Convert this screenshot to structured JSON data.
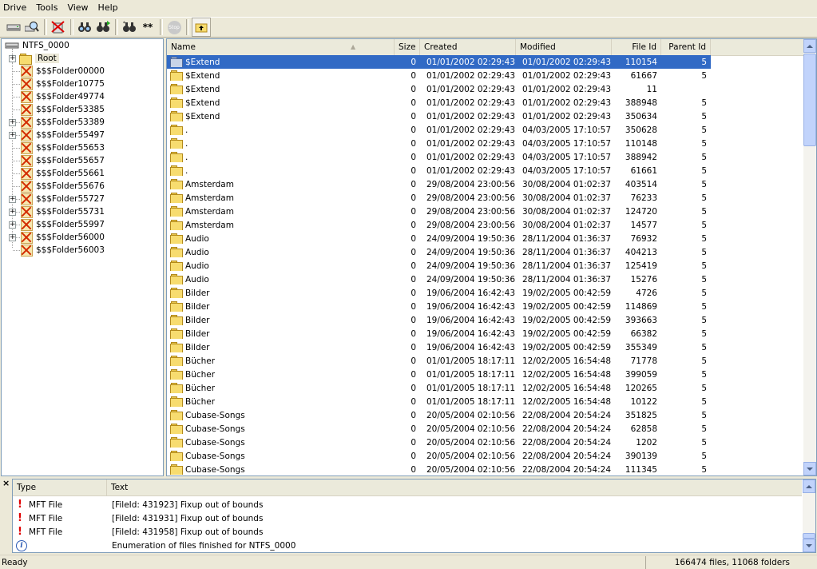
{
  "menu": [
    "Drive",
    "Tools",
    "View",
    "Help"
  ],
  "toolbar": {
    "buttons": [
      "drive-icon",
      "scan-drive-icon",
      "delete-icon",
      "find-icon",
      "find-next-icon",
      "filter-icon",
      "wildcard-icon",
      "stop-icon",
      "up-folder-icon"
    ],
    "stop_label": "Stop",
    "wildcard_label": "**"
  },
  "tree": {
    "drive": "NTFS_0000",
    "root": "Root",
    "folders": [
      {
        "label": "$$$Folder00000",
        "expandable": false
      },
      {
        "label": "$$$Folder10775",
        "expandable": false
      },
      {
        "label": "$$$Folder49774",
        "expandable": false
      },
      {
        "label": "$$$Folder53385",
        "expandable": false
      },
      {
        "label": "$$$Folder53389",
        "expandable": true
      },
      {
        "label": "$$$Folder55497",
        "expandable": true
      },
      {
        "label": "$$$Folder55653",
        "expandable": false
      },
      {
        "label": "$$$Folder55657",
        "expandable": false
      },
      {
        "label": "$$$Folder55661",
        "expandable": false
      },
      {
        "label": "$$$Folder55676",
        "expandable": false
      },
      {
        "label": "$$$Folder55727",
        "expandable": true
      },
      {
        "label": "$$$Folder55731",
        "expandable": true
      },
      {
        "label": "$$$Folder55997",
        "expandable": true
      },
      {
        "label": "$$$Folder56000",
        "expandable": true
      },
      {
        "label": "$$$Folder56003",
        "expandable": false
      }
    ]
  },
  "list": {
    "columns": {
      "name": "Name",
      "size": "Size",
      "created": "Created",
      "modified": "Modified",
      "file_id": "File Id",
      "parent_id": "Parent Id"
    },
    "rows": [
      {
        "name": "$Extend",
        "size": "0",
        "created": "01/01/2002 02:29:43",
        "modified": "01/01/2002 02:29:43",
        "file_id": "110154",
        "parent_id": "5",
        "selected": true
      },
      {
        "name": "$Extend",
        "size": "0",
        "created": "01/01/2002 02:29:43",
        "modified": "01/01/2002 02:29:43",
        "file_id": "61667",
        "parent_id": "5"
      },
      {
        "name": "$Extend",
        "size": "0",
        "created": "01/01/2002 02:29:43",
        "modified": "01/01/2002 02:29:43",
        "file_id": "11",
        "parent_id": ""
      },
      {
        "name": "$Extend",
        "size": "0",
        "created": "01/01/2002 02:29:43",
        "modified": "01/01/2002 02:29:43",
        "file_id": "388948",
        "parent_id": "5"
      },
      {
        "name": "$Extend",
        "size": "0",
        "created": "01/01/2002 02:29:43",
        "modified": "01/01/2002 02:29:43",
        "file_id": "350634",
        "parent_id": "5"
      },
      {
        "name": ".",
        "size": "0",
        "created": "01/01/2002 02:29:43",
        "modified": "04/03/2005 17:10:57",
        "file_id": "350628",
        "parent_id": "5"
      },
      {
        "name": ".",
        "size": "0",
        "created": "01/01/2002 02:29:43",
        "modified": "04/03/2005 17:10:57",
        "file_id": "110148",
        "parent_id": "5"
      },
      {
        "name": ".",
        "size": "0",
        "created": "01/01/2002 02:29:43",
        "modified": "04/03/2005 17:10:57",
        "file_id": "388942",
        "parent_id": "5"
      },
      {
        "name": ".",
        "size": "0",
        "created": "01/01/2002 02:29:43",
        "modified": "04/03/2005 17:10:57",
        "file_id": "61661",
        "parent_id": "5"
      },
      {
        "name": "Amsterdam",
        "size": "0",
        "created": "29/08/2004 23:00:56",
        "modified": "30/08/2004 01:02:37",
        "file_id": "403514",
        "parent_id": "5"
      },
      {
        "name": "Amsterdam",
        "size": "0",
        "created": "29/08/2004 23:00:56",
        "modified": "30/08/2004 01:02:37",
        "file_id": "76233",
        "parent_id": "5"
      },
      {
        "name": "Amsterdam",
        "size": "0",
        "created": "29/08/2004 23:00:56",
        "modified": "30/08/2004 01:02:37",
        "file_id": "124720",
        "parent_id": "5"
      },
      {
        "name": "Amsterdam",
        "size": "0",
        "created": "29/08/2004 23:00:56",
        "modified": "30/08/2004 01:02:37",
        "file_id": "14577",
        "parent_id": "5"
      },
      {
        "name": "Audio",
        "size": "0",
        "created": "24/09/2004 19:50:36",
        "modified": "28/11/2004 01:36:37",
        "file_id": "76932",
        "parent_id": "5"
      },
      {
        "name": "Audio",
        "size": "0",
        "created": "24/09/2004 19:50:36",
        "modified": "28/11/2004 01:36:37",
        "file_id": "404213",
        "parent_id": "5"
      },
      {
        "name": "Audio",
        "size": "0",
        "created": "24/09/2004 19:50:36",
        "modified": "28/11/2004 01:36:37",
        "file_id": "125419",
        "parent_id": "5"
      },
      {
        "name": "Audio",
        "size": "0",
        "created": "24/09/2004 19:50:36",
        "modified": "28/11/2004 01:36:37",
        "file_id": "15276",
        "parent_id": "5"
      },
      {
        "name": "Bilder",
        "size": "0",
        "created": "19/06/2004 16:42:43",
        "modified": "19/02/2005 00:42:59",
        "file_id": "4726",
        "parent_id": "5"
      },
      {
        "name": "Bilder",
        "size": "0",
        "created": "19/06/2004 16:42:43",
        "modified": "19/02/2005 00:42:59",
        "file_id": "114869",
        "parent_id": "5"
      },
      {
        "name": "Bilder",
        "size": "0",
        "created": "19/06/2004 16:42:43",
        "modified": "19/02/2005 00:42:59",
        "file_id": "393663",
        "parent_id": "5"
      },
      {
        "name": "Bilder",
        "size": "0",
        "created": "19/06/2004 16:42:43",
        "modified": "19/02/2005 00:42:59",
        "file_id": "66382",
        "parent_id": "5"
      },
      {
        "name": "Bilder",
        "size": "0",
        "created": "19/06/2004 16:42:43",
        "modified": "19/02/2005 00:42:59",
        "file_id": "355349",
        "parent_id": "5"
      },
      {
        "name": "Bücher",
        "size": "0",
        "created": "01/01/2005 18:17:11",
        "modified": "12/02/2005 16:54:48",
        "file_id": "71778",
        "parent_id": "5"
      },
      {
        "name": "Bücher",
        "size": "0",
        "created": "01/01/2005 18:17:11",
        "modified": "12/02/2005 16:54:48",
        "file_id": "399059",
        "parent_id": "5"
      },
      {
        "name": "Bücher",
        "size": "0",
        "created": "01/01/2005 18:17:11",
        "modified": "12/02/2005 16:54:48",
        "file_id": "120265",
        "parent_id": "5"
      },
      {
        "name": "Bücher",
        "size": "0",
        "created": "01/01/2005 18:17:11",
        "modified": "12/02/2005 16:54:48",
        "file_id": "10122",
        "parent_id": "5"
      },
      {
        "name": "Cubase-Songs",
        "size": "0",
        "created": "20/05/2004 02:10:56",
        "modified": "22/08/2004 20:54:24",
        "file_id": "351825",
        "parent_id": "5"
      },
      {
        "name": "Cubase-Songs",
        "size": "0",
        "created": "20/05/2004 02:10:56",
        "modified": "22/08/2004 20:54:24",
        "file_id": "62858",
        "parent_id": "5"
      },
      {
        "name": "Cubase-Songs",
        "size": "0",
        "created": "20/05/2004 02:10:56",
        "modified": "22/08/2004 20:54:24",
        "file_id": "1202",
        "parent_id": "5"
      },
      {
        "name": "Cubase-Songs",
        "size": "0",
        "created": "20/05/2004 02:10:56",
        "modified": "22/08/2004 20:54:24",
        "file_id": "390139",
        "parent_id": "5"
      },
      {
        "name": "Cubase-Songs",
        "size": "0",
        "created": "20/05/2004 02:10:56",
        "modified": "22/08/2004 20:54:24",
        "file_id": "111345",
        "parent_id": "5"
      }
    ]
  },
  "log": {
    "close_glyph": "×",
    "columns": {
      "type": "Type",
      "text": "Text"
    },
    "rows": [
      {
        "icon": "error-icon",
        "type": "MFT File",
        "text": "[FileId: 431923] Fixup out of bounds"
      },
      {
        "icon": "error-icon",
        "type": "MFT File",
        "text": "[FileId: 431931] Fixup out of bounds"
      },
      {
        "icon": "error-icon",
        "type": "MFT File",
        "text": "[FileId: 431958] Fixup out of bounds"
      },
      {
        "icon": "info-icon",
        "type": "",
        "text": "Enumeration of files finished for NTFS_0000"
      }
    ]
  },
  "status": {
    "left": "Ready",
    "right": "166474 files, 11068 folders"
  },
  "colors": {
    "selection": "#316ac5",
    "window_bg": "#ece9d8",
    "error": "#e00000"
  }
}
